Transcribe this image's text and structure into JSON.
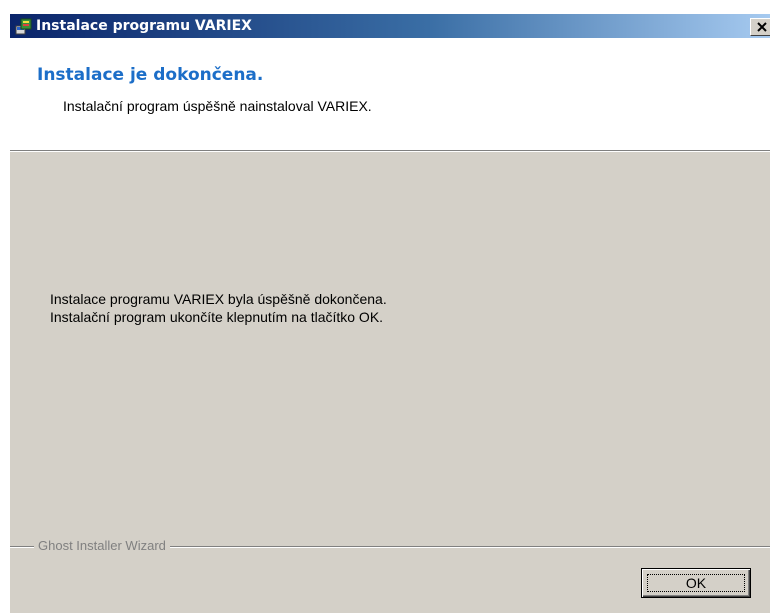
{
  "window": {
    "title": "Instalace programu VARIEX",
    "close_glyph": "✕"
  },
  "header": {
    "title": "Instalace je dokončena.",
    "subtitle": "Instalační program úspěšně nainstaloval VARIEX."
  },
  "body": {
    "message_line1": "Instalace programu VARIEX byla úspěšně dokončena.",
    "message_line2": "Instalační program ukončíte klepnutím na tlačítko OK."
  },
  "footer": {
    "brand": "Ghost Installer Wizard",
    "ok_label": "OK"
  },
  "icons": {
    "app": "installer-icon",
    "close": "close-icon"
  },
  "colors": {
    "title_gradient_start": "#0a246a",
    "title_gradient_end": "#a6caf0",
    "header_title": "#1c6ec8",
    "dialog_face": "#d4d0c8"
  }
}
